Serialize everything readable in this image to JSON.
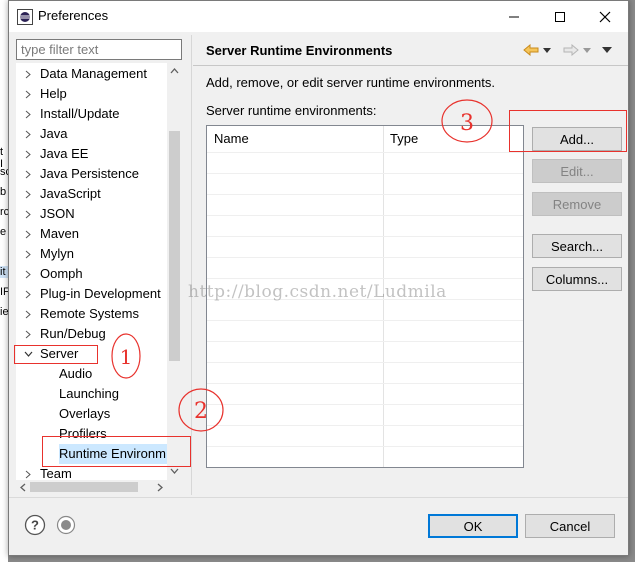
{
  "window": {
    "title": "Preferences"
  },
  "behind_fragments": [
    "t I",
    "sc",
    "b",
    "rc",
    "e",
    "it",
    "IF",
    "ie"
  ],
  "filter": {
    "placeholder": "type filter text",
    "value": ""
  },
  "tree": {
    "items": [
      {
        "label": "Data Management",
        "expanded": false
      },
      {
        "label": "Help",
        "expanded": false
      },
      {
        "label": "Install/Update",
        "expanded": false
      },
      {
        "label": "Java",
        "expanded": false
      },
      {
        "label": "Java EE",
        "expanded": false
      },
      {
        "label": "Java Persistence",
        "expanded": false
      },
      {
        "label": "JavaScript",
        "expanded": false
      },
      {
        "label": "JSON",
        "expanded": false
      },
      {
        "label": "Maven",
        "expanded": false
      },
      {
        "label": "Mylyn",
        "expanded": false
      },
      {
        "label": "Oomph",
        "expanded": false
      },
      {
        "label": "Plug-in Development",
        "expanded": false
      },
      {
        "label": "Remote Systems",
        "expanded": false
      },
      {
        "label": "Run/Debug",
        "expanded": false
      },
      {
        "label": "Server",
        "expanded": true
      }
    ],
    "server_children": [
      "Audio",
      "Launching",
      "Overlays",
      "Profilers",
      "Runtime Environm"
    ],
    "selected": "Runtime Environm",
    "after": [
      {
        "label": "Team",
        "expanded": false
      }
    ]
  },
  "page": {
    "title": "Server Runtime Environments",
    "description": "Add, remove, or edit server runtime environments.",
    "list_label": "Server runtime environments:",
    "columns": [
      "Name",
      "Type"
    ]
  },
  "buttons": {
    "add": "Add...",
    "edit": "Edit...",
    "remove": "Remove",
    "search": "Search...",
    "columns": "Columns..."
  },
  "footer": {
    "ok": "OK",
    "cancel": "Cancel"
  },
  "icons": {
    "app": "eclipse-icon",
    "back": "back-arrow-icon",
    "forward": "forward-arrow-icon",
    "help": "help-icon",
    "prefs": "preferences-record-icon"
  },
  "watermark": "http://blog.csdn.net/Ludmila",
  "annotations": [
    "1",
    "2",
    "3"
  ],
  "colors": {
    "accent": "#0078d7",
    "selection": "#cce8ff",
    "annotation": "#e8322d",
    "back_arrow": "#e6a23c"
  }
}
